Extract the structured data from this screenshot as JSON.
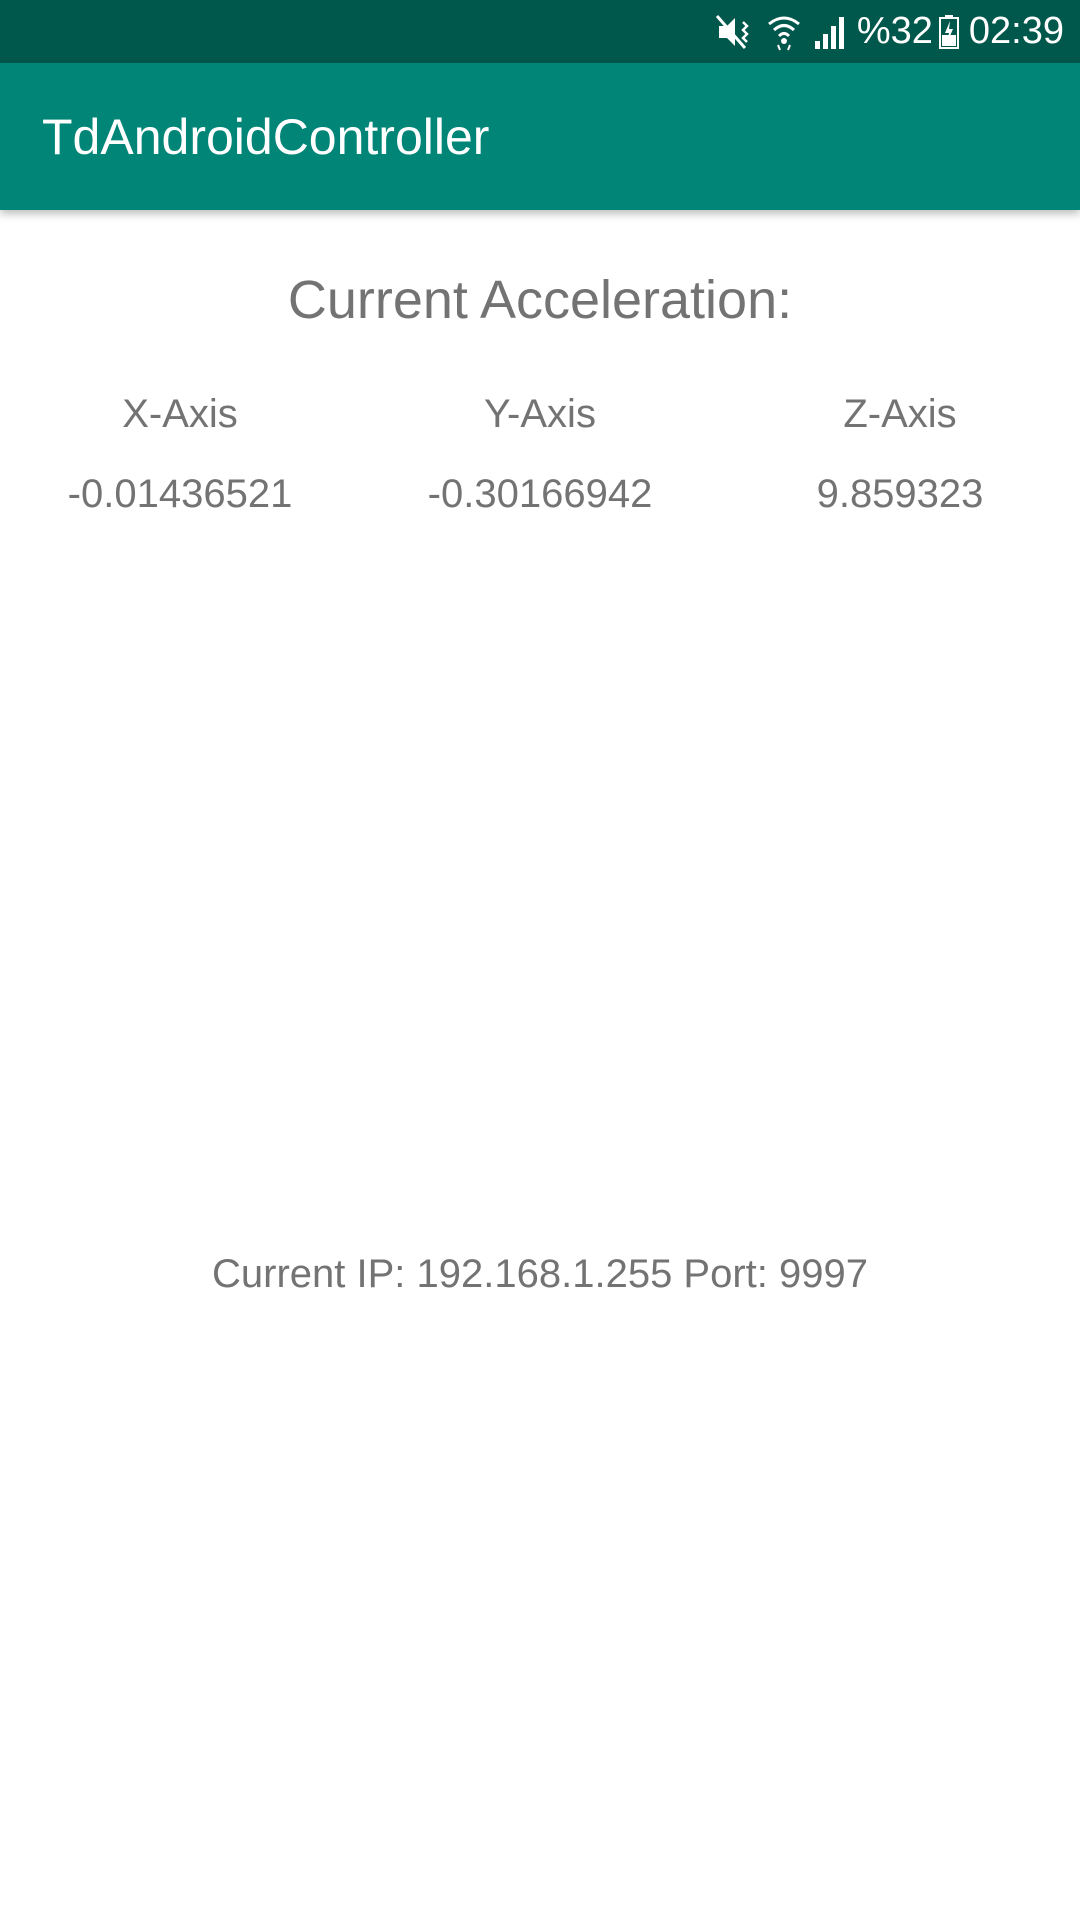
{
  "status_bar": {
    "battery_text": "%32",
    "time": "02:39",
    "icons": [
      "mute-vibrate-icon",
      "wifi-icon",
      "signal-icon",
      "battery-charging-icon"
    ]
  },
  "app_bar": {
    "title": "TdAndroidController"
  },
  "acceleration": {
    "heading": "Current Acceleration:",
    "axes": [
      {
        "label": "X-Axis",
        "value": "-0.01436521"
      },
      {
        "label": "Y-Axis",
        "value": "-0.30166942"
      },
      {
        "label": "Z-Axis",
        "value": "9.859323"
      }
    ]
  },
  "connection": {
    "text": "Current IP: 192.168.1.255 Port: 9997"
  },
  "colors": {
    "status_bar": "#00574b",
    "app_bar": "#008577",
    "text_gray": "#737373",
    "background": "#ffffff"
  }
}
